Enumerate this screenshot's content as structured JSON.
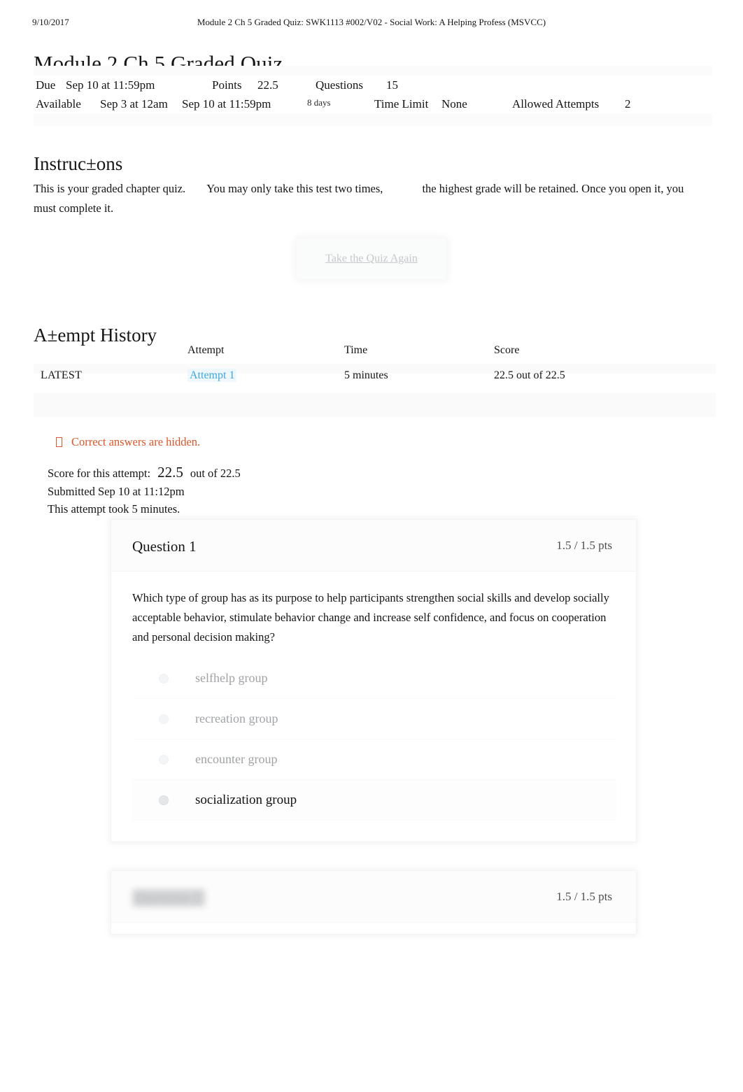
{
  "print_header": {
    "date": "9/10/2017",
    "title": "Module 2 Ch 5 Graded Quiz: SWK1113 #002/V02 - Social Work: A Helping Profess (MSVCC)"
  },
  "page_title": "Module 2 Ch 5 Graded Quiz",
  "quiz_meta": {
    "due_label": "Due",
    "due_value": "Sep 10 at 11:59pm",
    "points_label": "Points",
    "points_value": "22.5",
    "questions_label": "Questions",
    "questions_value": "15",
    "available_label": "Available",
    "available_from": "Sep 3 at 12am",
    "available_until": "Sep 10 at 11:59pm",
    "available_duration": "8 days",
    "time_limit_label": "Time Limit",
    "time_limit_value": "None",
    "allowed_attempts_label": "Allowed Attempts",
    "allowed_attempts_value": "2"
  },
  "instructions": {
    "heading": "Instruc±ons",
    "text_part1": "This is your graded chapter quiz.",
    "text_part2": "You may only take this test two times,",
    "text_part3": "the highest grade will be retained. Once you open it, you must complete it."
  },
  "retake_button": {
    "label": "Take the Quiz Again"
  },
  "attempt_history": {
    "heading": "A±empt History",
    "columns": {
      "kept": "",
      "attempt": "Attempt",
      "time": "Time",
      "score": "Score"
    },
    "rows": [
      {
        "kept": "LATEST",
        "attempt": "Attempt 1",
        "time": "5 minutes",
        "score": "22.5 out of 22.5"
      }
    ]
  },
  "hidden_answers_notice": {
    "text": "Correct answers are hidden.",
    "color": "#d9572a",
    "icon": "info-box-icon"
  },
  "attempt_summary": {
    "score_label": "Score for this attempt:",
    "score_value": "22.5",
    "score_out_of": "out of 22.5",
    "submitted": "Submitted Sep 10 at 11:12pm",
    "duration": "This attempt took 5 minutes."
  },
  "questions": [
    {
      "title": "Question 1",
      "points": "1.5 / 1.5 pts",
      "prompt": "Which type of group has as its purpose to help participants strengthen social skills and develop socially acceptable behavior, stimulate behavior change and increase self confidence, and focus on cooperation and personal decision making?",
      "answers": [
        {
          "label": "selfhelp group",
          "selected": false
        },
        {
          "label": "recreation group",
          "selected": false
        },
        {
          "label": "encounter group",
          "selected": false
        },
        {
          "label": "socialization group",
          "selected": true
        }
      ]
    },
    {
      "title": "Question 2",
      "points": "1.5 / 1.5 pts",
      "prompt": "",
      "answers": []
    }
  ],
  "colors": {
    "link": "#3da5e0",
    "notice": "#d9572a",
    "text": "#141414",
    "muted": "#a0a3a6"
  }
}
